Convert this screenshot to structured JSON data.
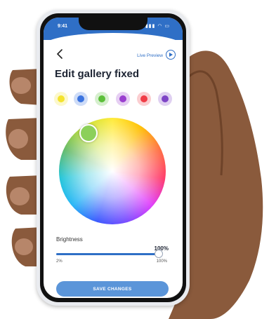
{
  "status_bar": {
    "time": "9:41",
    "icons": "▮▮▮ ◠ ▭"
  },
  "header": {
    "live_preview_label": "Live Preview"
  },
  "title": "Edit gallery fixed",
  "swatches": [
    {
      "color": "#f5e32e"
    },
    {
      "color": "#3d74e0"
    },
    {
      "color": "#5cbf3a"
    },
    {
      "color": "#9a3fcf"
    },
    {
      "color": "#f03c46"
    },
    {
      "color": "#7e44c6"
    }
  ],
  "color_wheel": {
    "selected_color": "#8cd05a"
  },
  "brightness": {
    "label": "Brightness",
    "value_label": "100%",
    "value_fraction": 0.97,
    "min_label": "2%",
    "max_label": "100%"
  },
  "save_button_label": "SAVE CHANGES",
  "colors": {
    "accent": "#2f6fc6",
    "button": "#5b95d9"
  }
}
